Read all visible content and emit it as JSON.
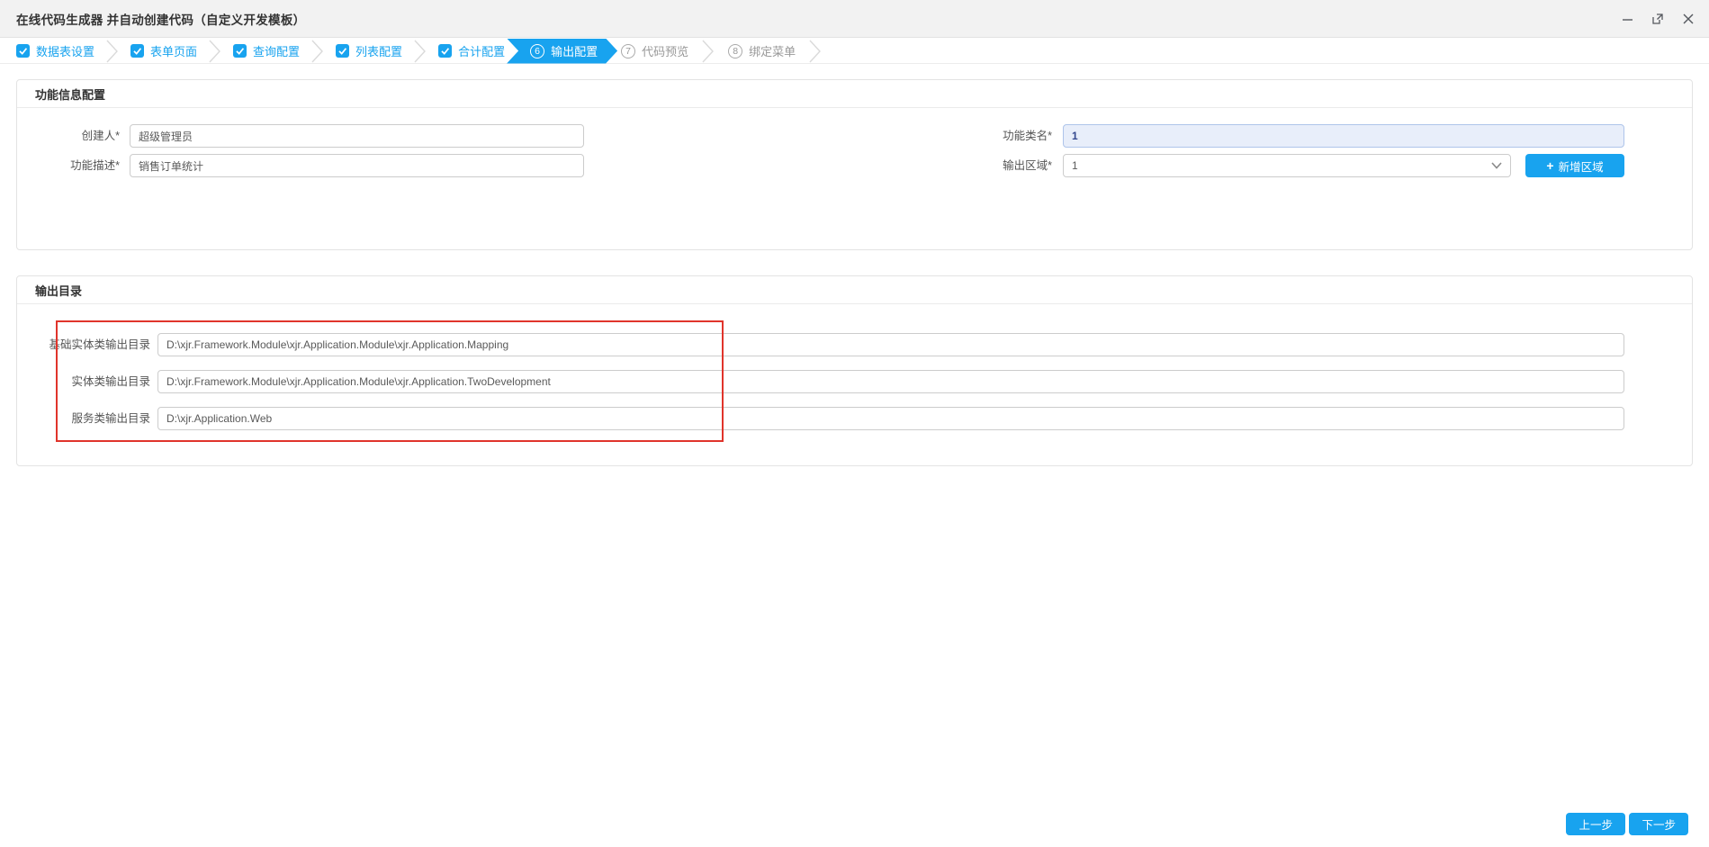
{
  "window": {
    "title": "在线代码生成器 并自动创建代码（自定义开发模板）"
  },
  "stepper": {
    "steps": [
      {
        "label": "数据表设置",
        "state": "done"
      },
      {
        "label": "表单页面",
        "state": "done"
      },
      {
        "label": "查询配置",
        "state": "done"
      },
      {
        "label": "列表配置",
        "state": "done"
      },
      {
        "label": "合计配置",
        "state": "done"
      },
      {
        "label": "输出配置",
        "state": "active",
        "number": "6"
      },
      {
        "label": "代码预览",
        "state": "pending",
        "number": "7"
      },
      {
        "label": "绑定菜单",
        "state": "pending",
        "number": "8"
      }
    ]
  },
  "function_info": {
    "section_title": "功能信息配置",
    "creator": {
      "label": "创建人*",
      "value": "超级管理员"
    },
    "description": {
      "label": "功能描述*",
      "value": "销售订单统计"
    },
    "class_name": {
      "label": "功能类名*",
      "value": "1"
    },
    "output_area": {
      "label": "输出区域*",
      "value": "1",
      "button_icon": "+",
      "button_label": "新增区域"
    }
  },
  "output_directory": {
    "section_title": "输出目录",
    "fields": [
      {
        "label": "基础实体类输出目录",
        "value": "D:\\xjr.Framework.Module\\xjr.Application.Module\\xjr.Application.Mapping"
      },
      {
        "label": "实体类输出目录",
        "value": "D:\\xjr.Framework.Module\\xjr.Application.Module\\xjr.Application.TwoDevelopment"
      },
      {
        "label": "服务类输出目录",
        "value": "D:\\xjr.Application.Web"
      }
    ]
  },
  "footer": {
    "prev_label": "上一步",
    "next_label": "下一步"
  },
  "colors": {
    "accent": "#18a3ef",
    "annotation_red": "#e0342b"
  }
}
